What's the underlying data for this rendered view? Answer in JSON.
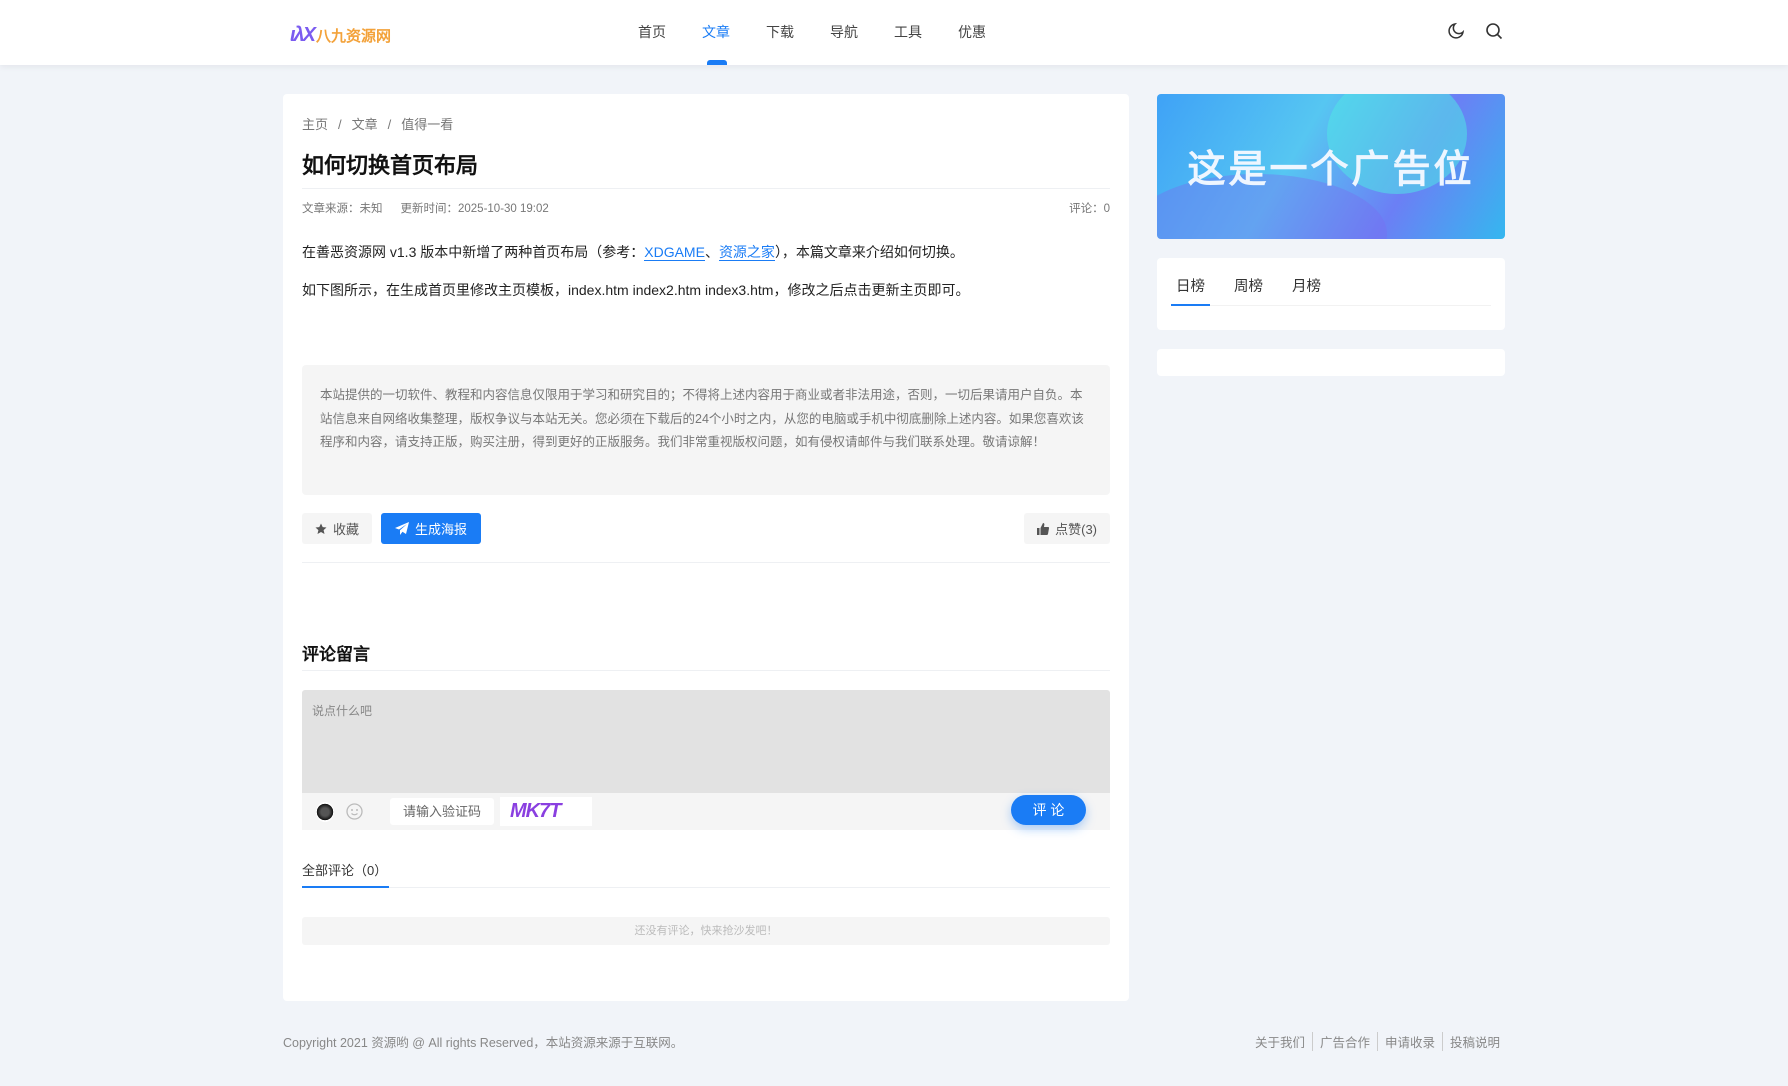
{
  "header": {
    "logo_mark": "ιλΧ",
    "logo_text": "八九资源网",
    "nav": [
      {
        "label": "首页"
      },
      {
        "label": "文章",
        "active": true
      },
      {
        "label": "下载"
      },
      {
        "label": "导航"
      },
      {
        "label": "工具"
      },
      {
        "label": "优惠"
      }
    ],
    "icons": [
      "moon-icon",
      "search-icon"
    ]
  },
  "breadcrumb": [
    "主页",
    "文章",
    "值得一看"
  ],
  "article": {
    "title": "如何切换首页布局",
    "source": "文章来源：未知",
    "updated": "更新时间：2025-10-30 19:02",
    "comments": "评论：0",
    "p1_before": "在善恶资源网 v1.3 版本中新增了两种首页布局（参考：",
    "link1": "XDGAME",
    "sep": "、",
    "link2": "资源之家",
    "p1_after": "），本篇文章来介绍如何切换。",
    "p2": "如下图所示，在生成首页里修改主页模板，index.htm index2.htm index3.htm，修改之后点击更新主页即可。",
    "notice": "本站提供的一切软件、教程和内容信息仅限用于学习和研究目的；不得将上述内容用于商业或者非法用途，否则，一切后果请用户自负。本站信息来自网络收集整理，版权争议与本站无关。您必须在下载后的24个小时之内，从您的电脑或手机中彻底删除上述内容。如果您喜欢该程序和内容，请支持正版，购买注册，得到更好的正版服务。我们非常重视版权问题，如有侵权请邮件与我们联系处理。敬请谅解！",
    "fav": "收藏",
    "poster": "生成海报",
    "like": "点赞(3)"
  },
  "comments": {
    "heading": "评论留言",
    "placeholder": "说点什么吧",
    "captcha_placeholder": "请输入验证码",
    "captcha_text": "MK7T",
    "submit": "评 论",
    "all_tab": "全部评论（0）",
    "empty": "还没有评论，快来抢沙发吧！"
  },
  "sidebar": {
    "ad_text": "这是一个广告位",
    "tabs": [
      "日榜",
      "周榜",
      "月榜"
    ]
  },
  "footer": {
    "copyright": "Copyright 2021 资源哟 @ All rights Reserved，本站资源来源于互联网。",
    "links": [
      "关于我们",
      "广告合作",
      "申请收录",
      "投稿说明"
    ]
  },
  "colors": {
    "accent": "#1a7cf5",
    "bg": "#f1f4f9"
  }
}
